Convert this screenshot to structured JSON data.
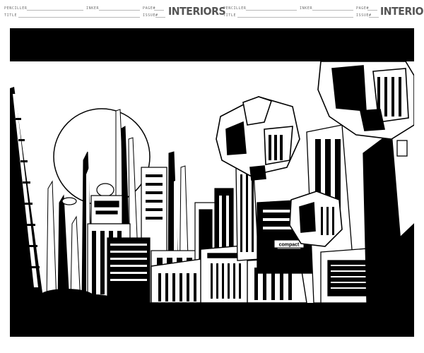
{
  "header_left": {
    "penciller_label": "PENCILLER",
    "inker_label": "INKER",
    "pager_label": "PAGE#",
    "title_label": "TITLE",
    "issue_label": "ISSUE#",
    "brand": "INTERIORS"
  },
  "header_right": {
    "penciller_label": "PENCILLER",
    "inker_label": "INKER",
    "pager_label": "PAGE#",
    "title_label": "TITLE",
    "issue_label": "ISSUE#",
    "brand": "INTERIORS"
  },
  "art": {
    "sign_text": "compact"
  },
  "colors": {
    "ink": "#000000",
    "paper": "#ffffff",
    "guide": "#cfcfcf"
  }
}
